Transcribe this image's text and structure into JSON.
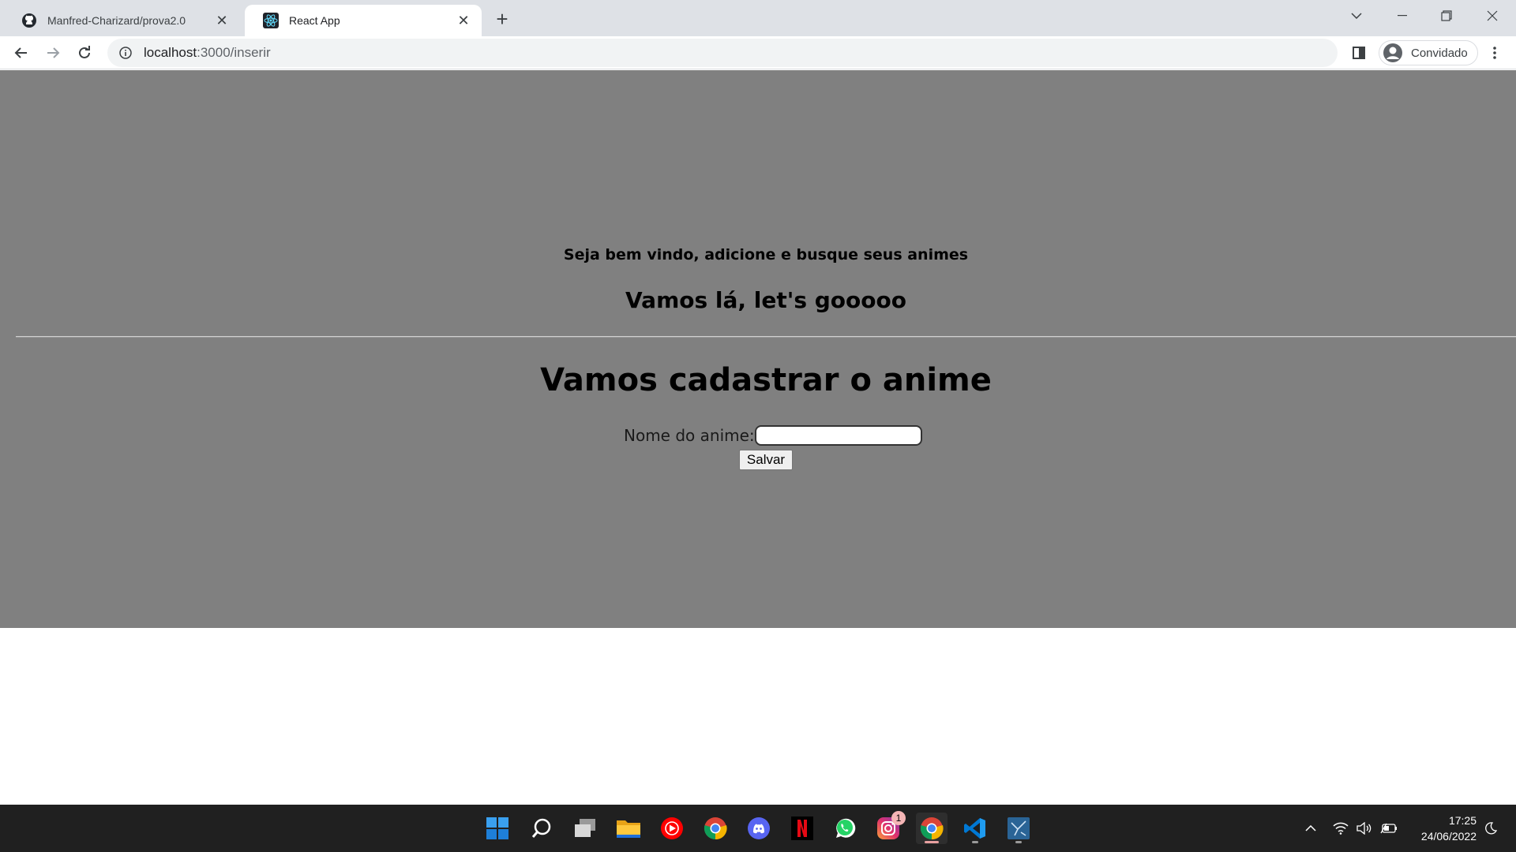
{
  "browser": {
    "tabs": [
      {
        "title": "Manfred-Charizard/prova2.0",
        "icon": "github-icon",
        "active": false
      },
      {
        "title": "React App",
        "icon": "react-icon",
        "active": true
      }
    ],
    "url": {
      "host": "localhost",
      "path": ":3000/inserir"
    },
    "profile_label": "Convidado"
  },
  "page": {
    "welcome_text": "Seja bem vindo, adicione e busque seus animes",
    "subtitle": "Vamos lá, let's gooooo",
    "form_title": "Vamos cadastrar o anime",
    "anime_name_label": "Nome do anime:",
    "anime_name_value": "",
    "save_label": "Salvar"
  },
  "taskbar": {
    "apps": [
      "start-icon",
      "search-icon",
      "task-view-icon",
      "file-explorer-icon",
      "youtube-music-icon",
      "chrome-icon",
      "discord-icon",
      "netflix-icon",
      "whatsapp-icon",
      "instagram-icon",
      "chrome-active-icon",
      "vscode-icon",
      "mysql-workbench-icon"
    ],
    "instagram_badge": "1",
    "time": "17:25",
    "date": "24/06/2022"
  },
  "colors": {
    "app_background": "#808080",
    "tabstrip": "#dee1e6",
    "taskbar": "#202020"
  }
}
